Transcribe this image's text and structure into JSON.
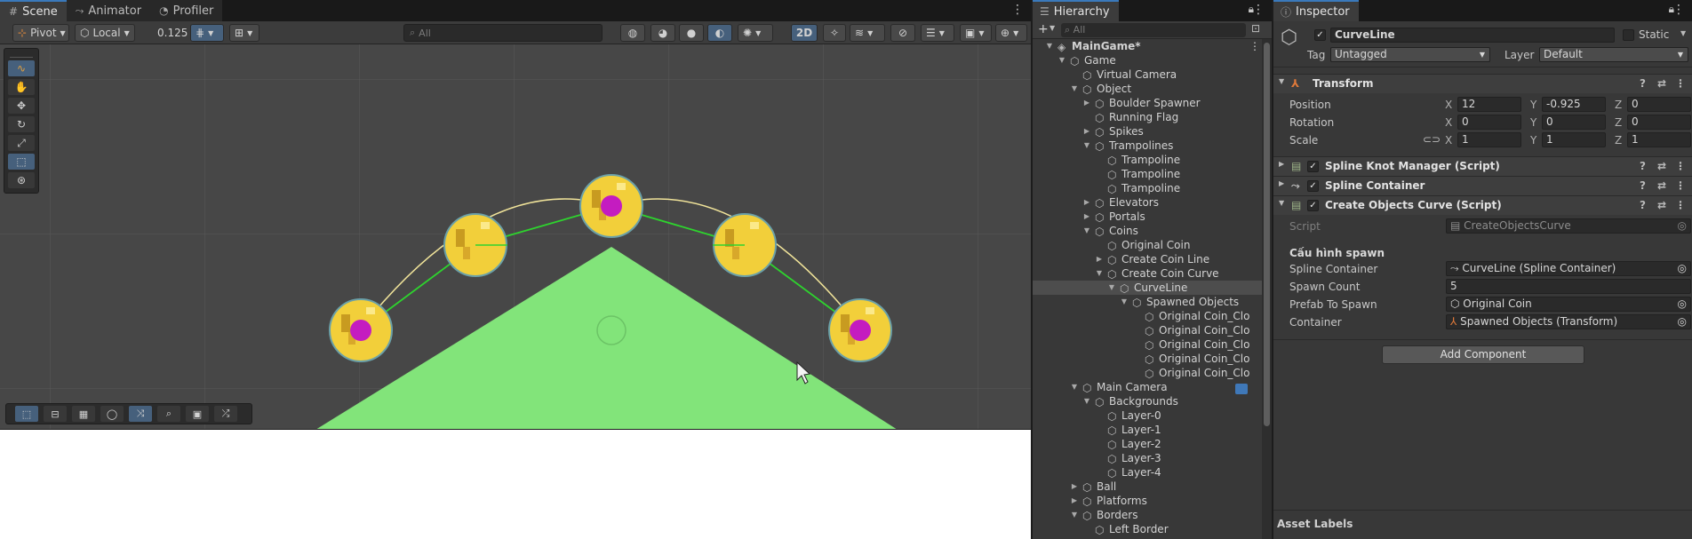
{
  "scene_tabs": [
    {
      "label": "Scene",
      "icon": "grid-icon"
    },
    {
      "label": "Animator",
      "icon": "animator-icon"
    },
    {
      "label": "Profiler",
      "icon": "profiler-icon"
    }
  ],
  "scene_toolbar": {
    "pivot_label": "Pivot",
    "space_label": "Local",
    "snap_value": "0.125",
    "search_placeholder": "All",
    "mode_2d_label": "2D"
  },
  "hierarchy": {
    "tab_label": "Hierarchy",
    "search_placeholder": "All",
    "items": [
      {
        "name": "MainGame*",
        "depth": 0,
        "arrow": "down",
        "icon": "unity-scene-icon",
        "bold": true
      },
      {
        "name": "Game",
        "depth": 1,
        "arrow": "down",
        "icon": "cube-icon"
      },
      {
        "name": "Virtual Camera",
        "depth": 2,
        "arrow": "",
        "icon": "cube-icon"
      },
      {
        "name": "Object",
        "depth": 2,
        "arrow": "down",
        "icon": "cube-icon"
      },
      {
        "name": "Boulder Spawner",
        "depth": 3,
        "arrow": "right",
        "icon": "cube-icon"
      },
      {
        "name": "Running Flag",
        "depth": 3,
        "arrow": "",
        "icon": "cube-icon"
      },
      {
        "name": "Spikes",
        "depth": 3,
        "arrow": "right",
        "icon": "cube-icon"
      },
      {
        "name": "Trampolines",
        "depth": 3,
        "arrow": "down",
        "icon": "cube-icon"
      },
      {
        "name": "Trampoline",
        "depth": 4,
        "arrow": "",
        "icon": "cube-icon"
      },
      {
        "name": "Trampoline",
        "depth": 4,
        "arrow": "",
        "icon": "cube-icon"
      },
      {
        "name": "Trampoline",
        "depth": 4,
        "arrow": "",
        "icon": "cube-icon"
      },
      {
        "name": "Elevators",
        "depth": 3,
        "arrow": "right",
        "icon": "cube-icon"
      },
      {
        "name": "Portals",
        "depth": 3,
        "arrow": "right",
        "icon": "cube-icon"
      },
      {
        "name": "Coins",
        "depth": 3,
        "arrow": "down",
        "icon": "cube-icon"
      },
      {
        "name": "Original Coin",
        "depth": 4,
        "arrow": "",
        "icon": "cube-icon"
      },
      {
        "name": "Create Coin Line",
        "depth": 4,
        "arrow": "right",
        "icon": "cube-icon"
      },
      {
        "name": "Create Coin Curve",
        "depth": 4,
        "arrow": "down",
        "icon": "cube-icon"
      },
      {
        "name": "CurveLine",
        "depth": 5,
        "arrow": "down",
        "icon": "cube-icon",
        "selected": true
      },
      {
        "name": "Spawned Objects",
        "depth": 6,
        "arrow": "down",
        "icon": "cube-icon"
      },
      {
        "name": "Original Coin_Clo",
        "depth": 7,
        "arrow": "",
        "icon": "cube-icon"
      },
      {
        "name": "Original Coin_Clo",
        "depth": 7,
        "arrow": "",
        "icon": "cube-icon"
      },
      {
        "name": "Original Coin_Clo",
        "depth": 7,
        "arrow": "",
        "icon": "cube-icon"
      },
      {
        "name": "Original Coin_Clo",
        "depth": 7,
        "arrow": "",
        "icon": "cube-icon"
      },
      {
        "name": "Original Coin_Clo",
        "depth": 7,
        "arrow": "",
        "icon": "cube-icon"
      },
      {
        "name": "Main Camera",
        "depth": 2,
        "arrow": "down",
        "icon": "cube-icon"
      },
      {
        "name": "Backgrounds",
        "depth": 3,
        "arrow": "down",
        "icon": "cube-icon"
      },
      {
        "name": "Layer-0",
        "depth": 4,
        "arrow": "",
        "icon": "cube-icon"
      },
      {
        "name": "Layer-1",
        "depth": 4,
        "arrow": "",
        "icon": "cube-icon"
      },
      {
        "name": "Layer-2",
        "depth": 4,
        "arrow": "",
        "icon": "cube-icon"
      },
      {
        "name": "Layer-3",
        "depth": 4,
        "arrow": "",
        "icon": "cube-icon"
      },
      {
        "name": "Layer-4",
        "depth": 4,
        "arrow": "",
        "icon": "cube-icon"
      },
      {
        "name": "Ball",
        "depth": 2,
        "arrow": "right",
        "icon": "cube-icon"
      },
      {
        "name": "Platforms",
        "depth": 2,
        "arrow": "right",
        "icon": "cube-icon"
      },
      {
        "name": "Borders",
        "depth": 2,
        "arrow": "down",
        "icon": "cube-icon"
      },
      {
        "name": "Left Border",
        "depth": 3,
        "arrow": "",
        "icon": "cube-icon"
      }
    ]
  },
  "inspector": {
    "tab_label": "Inspector",
    "object_name": "CurveLine",
    "static_label": "Static",
    "tag_label": "Tag",
    "tag_value": "Untagged",
    "layer_label": "Layer",
    "layer_value": "Default",
    "transform": {
      "title": "Transform",
      "position": {
        "label": "Position",
        "x": "12",
        "y": "-0.925",
        "z": "0"
      },
      "rotation": {
        "label": "Rotation",
        "x": "0",
        "y": "0",
        "z": "0"
      },
      "scale": {
        "label": "Scale",
        "x": "1",
        "y": "1",
        "z": "1"
      },
      "axis_x": "X",
      "axis_y": "Y",
      "axis_z": "Z"
    },
    "components": [
      {
        "title": "Spline Knot Manager (Script)"
      },
      {
        "title": "Spline Container"
      },
      {
        "title": "Create Objects Curve (Script)"
      }
    ],
    "script_label": "Script",
    "script_value": "CreateObjectsCurve",
    "section_header": "Cấu hình spawn",
    "fields": [
      {
        "label": "Spline Container",
        "value": "CurveLine (Spline Container)"
      },
      {
        "label": "Spawn Count",
        "value": "5"
      },
      {
        "label": "Prefab To Spawn",
        "value": "Original Coin"
      },
      {
        "label": "Container",
        "value": "Spawned Objects (Transform)"
      }
    ],
    "add_component_label": "Add Component",
    "asset_labels": "Asset Labels"
  },
  "colors": {
    "accent": "#3a79bb",
    "coin_gold": "#f2cf3a",
    "coin_magenta": "#c41cc0",
    "terrain_green": "#82e47a",
    "spline_line": "#2ed32e",
    "curve_yellow": "#f1e49a"
  }
}
